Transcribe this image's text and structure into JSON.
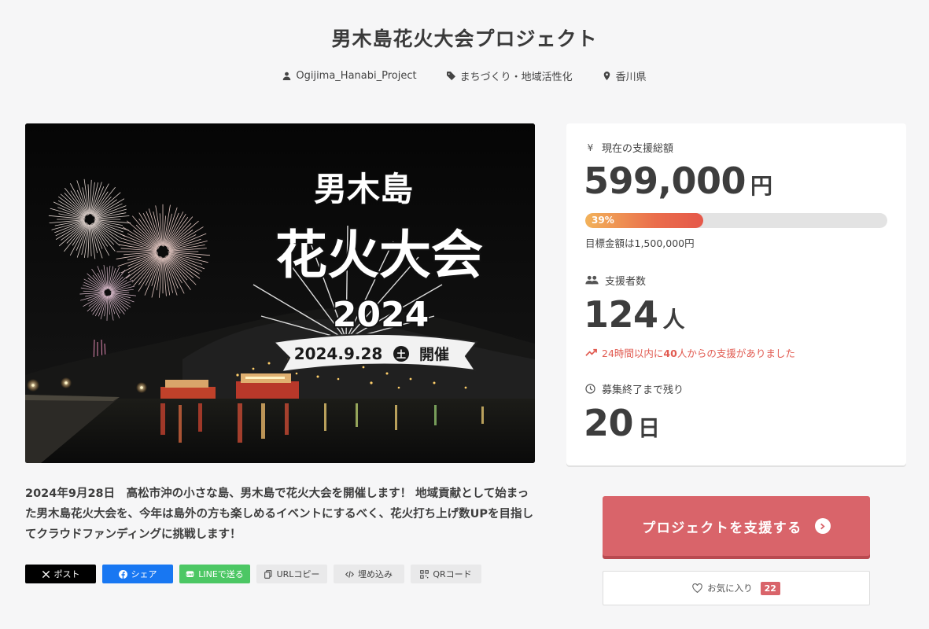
{
  "project": {
    "title": "男木島花火大会プロジェクト",
    "owner": "Ogijima_Hanabi_Project",
    "category": "まちづくり・地域活性化",
    "location": "香川県"
  },
  "hero": {
    "logo_line1": "男木島",
    "logo_line2": "花火大会",
    "logo_year": "2024",
    "banner_date": "2024.9.28",
    "banner_day": "土",
    "banner_suffix": "開催"
  },
  "description": "2024年9月28日　高松市沖の小さな島、男木島で花火大会を開催します！ 地域貢献として始まった男木島花火大会を、今年は島外の方も楽しめるイベントにするべく、花火打ち上げ数UPを目指してクラウドファンディングに挑戦します！",
  "share": {
    "post": "ポスト",
    "facebook": "シェア",
    "line": "LINEで送る",
    "url_copy": "URLコピー",
    "embed": "埋め込み",
    "qr": "QRコード"
  },
  "stats": {
    "total_label": "現在の支援総額",
    "total_value": "599,000",
    "total_unit": "円",
    "progress_percent": 39,
    "progress_label": "39%",
    "goal_text": "目標金額は1,500,000円",
    "supporters_label": "支援者数",
    "supporters_value": "124",
    "supporters_unit": "人",
    "trend_prefix": "24時間以内に",
    "trend_count": "40",
    "trend_suffix": "人からの支援がありました",
    "remaining_label": "募集終了まで残り",
    "remaining_value": "20",
    "remaining_unit": "日"
  },
  "actions": {
    "support_label": "プロジェクトを支援する",
    "favorite_label": "お気に入り",
    "favorite_count": "22"
  },
  "colors": {
    "accent": "#d9646a",
    "trend": "#e15a50",
    "facebook": "#1877f2",
    "line": "#4cc764"
  }
}
